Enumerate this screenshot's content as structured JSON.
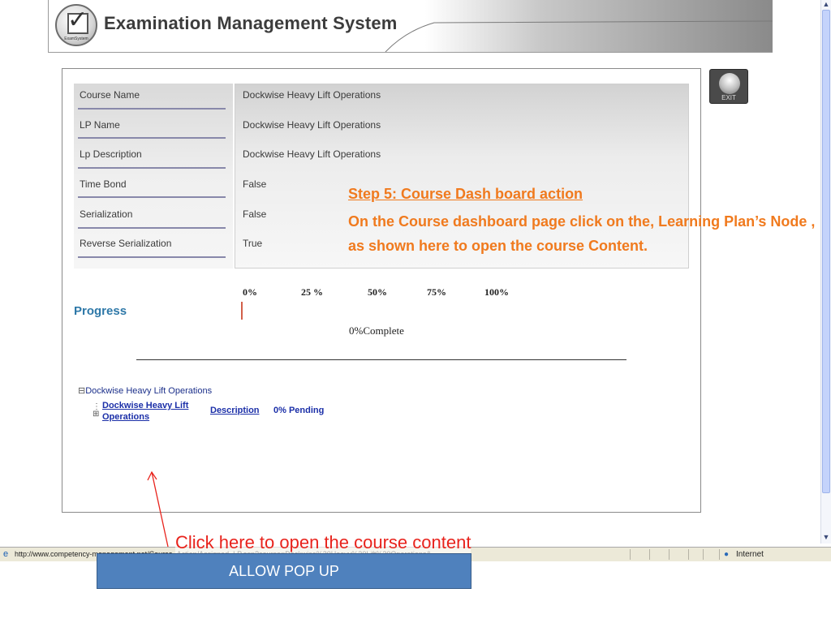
{
  "header": {
    "title": "Examination Management System",
    "logo_text": "ExamSystem"
  },
  "exit_button": {
    "label": "EXIT"
  },
  "info_table": [
    {
      "label": "Course Name",
      "value": "Dockwise Heavy Lift Operations"
    },
    {
      "label": "LP Name",
      "value": "Dockwise Heavy Lift Operations"
    },
    {
      "label": "Lp Description",
      "value": "Dockwise Heavy Lift Operations"
    },
    {
      "label": "Time Bond",
      "value": "False"
    },
    {
      "label": "Serialization",
      "value": "False"
    },
    {
      "label": "Reverse Serialization",
      "value": "True"
    }
  ],
  "progress": {
    "title": "Progress",
    "scale": [
      "0%",
      "25 %",
      "50%",
      "75%",
      "100%"
    ],
    "value_percent": 0,
    "complete_text": "0%Complete"
  },
  "tree": {
    "root_symbol": "⊟",
    "root_label": "Dockwise Heavy Lift Operations",
    "node_line1": "Dockwise Heavy Lift",
    "node_line2": "Operations",
    "description_link": "Description",
    "pending_text": "0% Pending"
  },
  "annotation": {
    "step_title": "Step 5: Course Dash board action",
    "step_text": "On the Course dashboard page click on the, Learning Plan’s Node , as shown here to open the course Content.",
    "click_note": "Click here to open the course content",
    "popup_button": "ALLOW POP UP"
  },
  "statusbar": {
    "url": "http://www.competency-management.net/Course_Action/Assigned_LP.asp?course=Dockwise%20Heavy%20Lift%20Operations&",
    "zone": "Internet"
  },
  "colors": {
    "accent_orange": "#f07a1e",
    "progress_blue": "#2e78a8",
    "link_blue": "#1b2fa8",
    "note_red": "#e8231c",
    "button_blue": "#4f81bd"
  }
}
